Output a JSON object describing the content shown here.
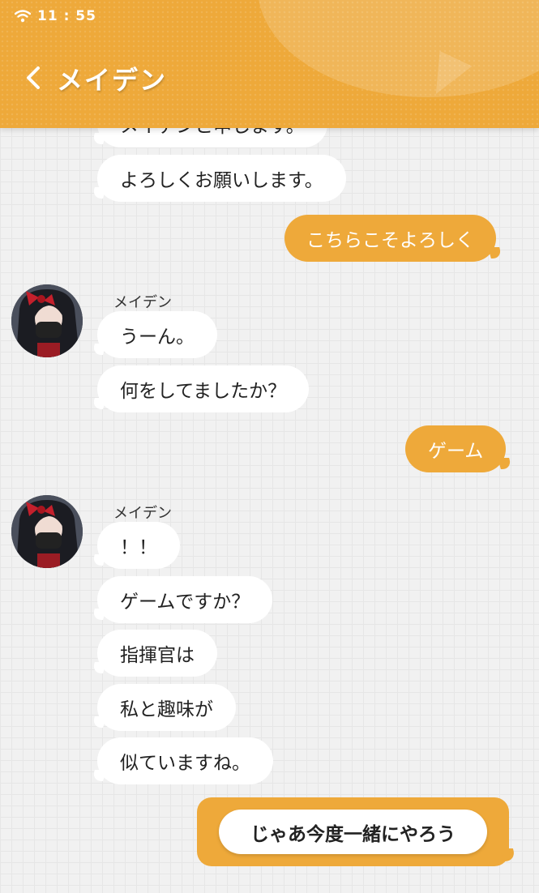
{
  "status": {
    "time": "11 : 55",
    "wifi_icon": "wifi-icon"
  },
  "header": {
    "title": "メイデン",
    "back_icon": "chevron-left-icon",
    "accent": "#eea93a"
  },
  "messages": [
    {
      "from": "npc",
      "text": "メイデンと申します。"
    },
    {
      "from": "npc",
      "text": "よろしくお願いします。"
    },
    {
      "from": "player",
      "text": "こちらこそよろしく"
    },
    {
      "from": "npc",
      "sender": "メイデン",
      "text": "うーん。"
    },
    {
      "from": "npc",
      "text": "何をしてましたか？"
    },
    {
      "from": "player",
      "text": "ゲーム"
    },
    {
      "from": "npc",
      "sender": "メイデン",
      "text": "！！"
    },
    {
      "from": "npc",
      "text": "ゲームですか？"
    },
    {
      "from": "npc",
      "text": "指揮官は"
    },
    {
      "from": "npc",
      "text": "私と趣味が"
    },
    {
      "from": "npc",
      "text": "似ていますね。"
    }
  ],
  "reply_choice": {
    "label": "じゃあ今度一緒にやろう"
  }
}
